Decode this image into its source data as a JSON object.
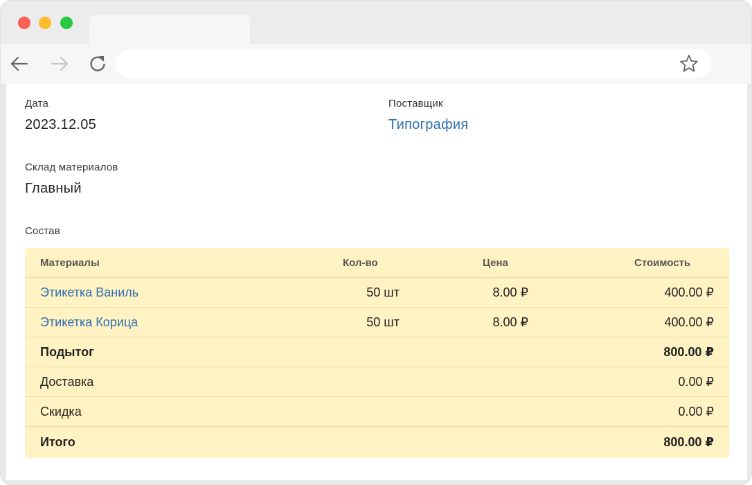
{
  "browser": {
    "address_value": "",
    "icons": [
      "back-icon",
      "forward-icon",
      "reload-icon",
      "star-icon"
    ]
  },
  "document": {
    "date_label": "Дата",
    "date_value": "2023.12.05",
    "supplier_label": "Поставщик",
    "supplier_value": "Типография",
    "warehouse_label": "Склад материалов",
    "warehouse_value": "Главный",
    "composition_label": "Состав"
  },
  "table": {
    "headers": {
      "material": "Материалы",
      "qty": "Кол-во",
      "price": "Цена",
      "cost": "Стоимость"
    },
    "items": [
      {
        "material": "Этикетка Ваниль",
        "qty": "50 шт",
        "price": "8.00 ₽",
        "cost": "400.00 ₽"
      },
      {
        "material": "Этикетка Корица",
        "qty": "50 шт",
        "price": "8.00 ₽",
        "cost": "400.00 ₽"
      }
    ],
    "subtotal": {
      "label": "Подытог",
      "value": "800.00 ₽"
    },
    "delivery": {
      "label": "Доставка",
      "value": "0.00 ₽"
    },
    "discount": {
      "label": "Скидка",
      "value": "0.00 ₽"
    },
    "total": {
      "label": "Итого",
      "value": "800.00 ₽"
    }
  },
  "colors": {
    "table_bg": "#fff3c4",
    "link": "#2f6fb0",
    "window_chrome": "#ececec"
  }
}
